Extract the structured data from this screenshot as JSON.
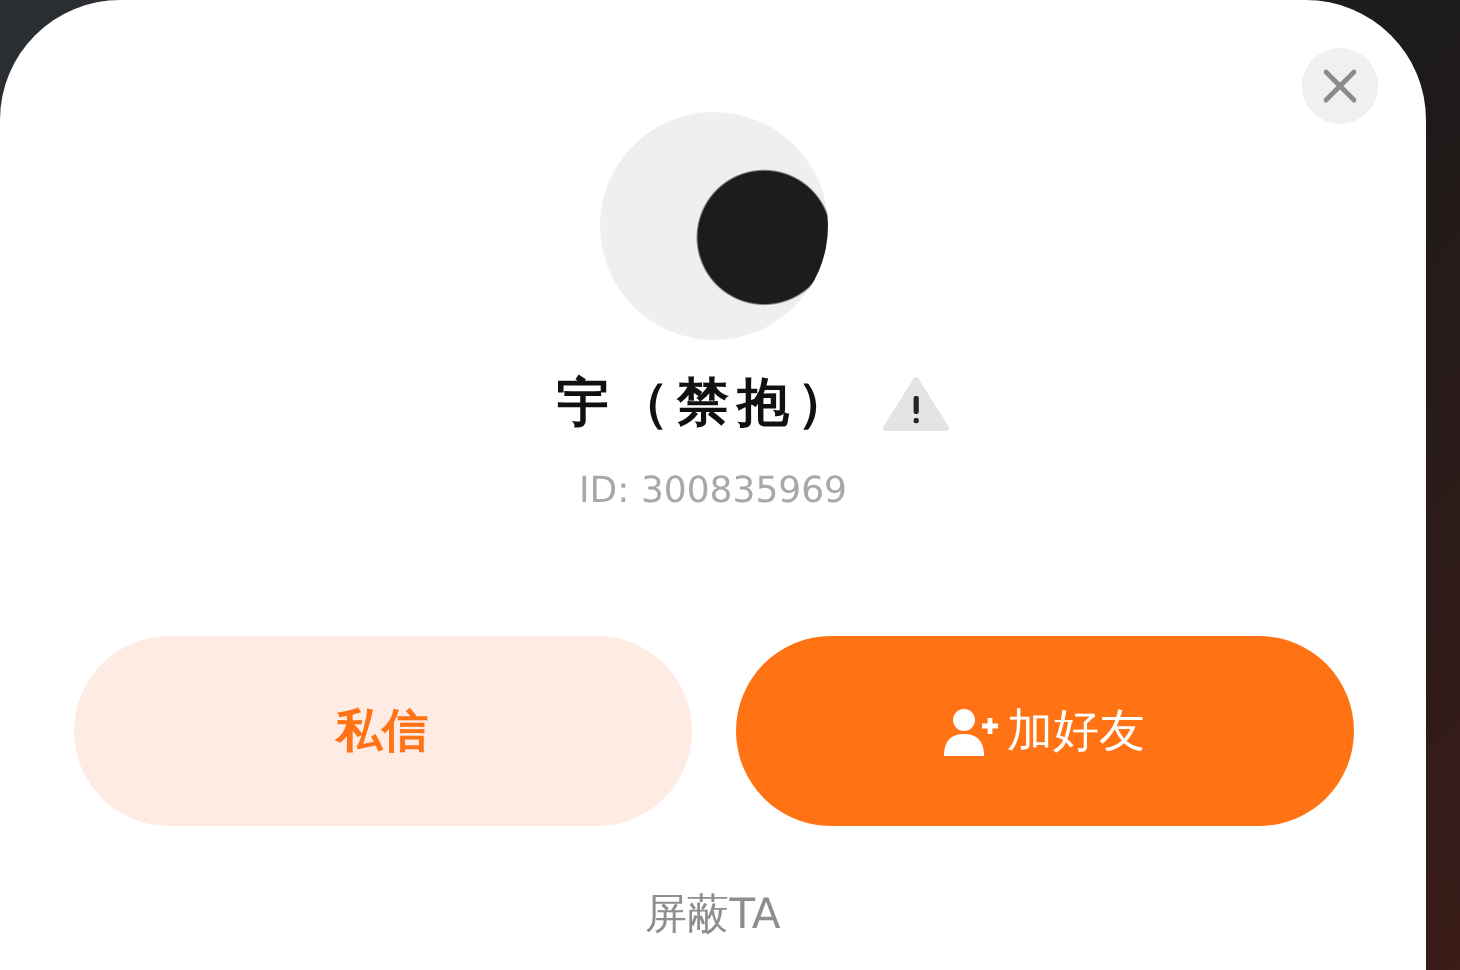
{
  "profile": {
    "name": "宇（禁抱）",
    "id_text": "ID: 300835969"
  },
  "actions": [
    {
      "label": "私信",
      "kind": "secondary"
    },
    {
      "label": "加好友",
      "kind": "primary"
    }
  ],
  "block_link": "屏蔽TA"
}
